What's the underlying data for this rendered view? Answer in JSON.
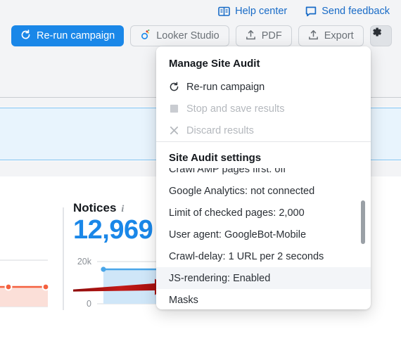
{
  "top_links": [
    {
      "label": "Help center",
      "icon": "help-book-icon"
    },
    {
      "label": "Send feedback",
      "icon": "speech-bubble-icon"
    }
  ],
  "toolbar": {
    "rerun_label": "Re-run campaign",
    "rerun_icon": "refresh-icon",
    "looker_label": "Looker Studio",
    "looker_icon": "looker-studio-icon",
    "pdf_label": "PDF",
    "pdf_icon": "upload-icon",
    "export_label": "Export",
    "export_icon": "upload-icon",
    "gear_icon": "gear-icon"
  },
  "widgets": {
    "notices": {
      "title": "Notices",
      "info_icon": "info-icon",
      "value": "12,969",
      "axis_top": "20k",
      "axis_bottom": "0"
    }
  },
  "menu": {
    "section_manage": {
      "heading": "Manage Site Audit",
      "items": [
        {
          "label": "Re-run campaign",
          "icon": "refresh-icon",
          "disabled": false
        },
        {
          "label": "Stop and save results",
          "icon": "stop-square-icon",
          "disabled": true
        },
        {
          "label": "Discard results",
          "icon": "close-x-icon",
          "disabled": true
        }
      ]
    },
    "section_settings": {
      "heading": "Site Audit settings",
      "items": [
        {
          "label": "Crawl AMP pages first: off",
          "highlighted": false
        },
        {
          "label": "Google Analytics: not connected",
          "highlighted": false
        },
        {
          "label": "Limit of checked pages: 2,000",
          "highlighted": false
        },
        {
          "label": "User agent: GoogleBot-Mobile",
          "highlighted": false
        },
        {
          "label": "Crawl-delay: 1 URL per 2 seconds",
          "highlighted": false
        },
        {
          "label": "JS-rendering: Enabled",
          "highlighted": true
        },
        {
          "label": "Masks",
          "highlighted": false
        }
      ]
    }
  },
  "colors": {
    "accent_blue": "#1a87e8",
    "link_blue": "#186bc7",
    "arrow_red": "#b01010",
    "chart_orange": "#f4603e",
    "chart_blue": "#49a6e9",
    "banner_blue": "#e8f4fd"
  }
}
